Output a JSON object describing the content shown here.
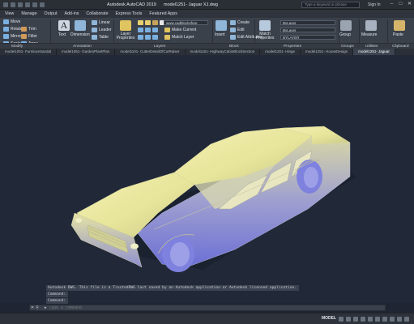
{
  "titlebar": {
    "app_title": "Autodesk AutoCAD 2019",
    "file_title": "model1251- Jaguar XJ.dwg",
    "search_placeholder": "Type a keyword or phrase",
    "signin": "Sign In"
  },
  "menu": [
    "View",
    "Manage",
    "Output",
    "Add-ins",
    "Collaborate",
    "Express Tools",
    "Featured Apps"
  ],
  "ribbon": {
    "modify": {
      "move": "Move",
      "rotate": "Rotate",
      "trim": "Trim",
      "copy": "Copy",
      "mirror": "Mirror",
      "fillet": "Fillet",
      "stretch": "Stretch",
      "scale": "Scale",
      "array": "Array"
    },
    "annotation": {
      "text": "Text",
      "dimension": "Dimension",
      "linear": "Linear",
      "leader": "Leader",
      "table": "Table"
    },
    "layers": {
      "layer_properties": "Layer Properties",
      "layer_value": "www.cadblocksfree",
      "make_current": "Make Current",
      "match_layer": "Match Layer"
    },
    "block": {
      "insert": "Insert",
      "create": "Create",
      "edit": "Edit",
      "edit_attributes": "Edit Attributes"
    },
    "properties": {
      "match_properties": "Match Properties",
      "color": "ByLayer",
      "linetype": "ByLayer",
      "lineweight": "BYLAYER"
    },
    "groups": {
      "group": "Group"
    },
    "utilities": {
      "measure": "Measure"
    },
    "clipboard": {
      "paste": "Paste"
    }
  },
  "panels": [
    "Modify",
    "Annotation",
    "Layers",
    "Block",
    "Properties",
    "Groups",
    "Utilities",
    "Clipboard"
  ],
  "file_tabs": [
    {
      "label": "model1001- FurnitureSandal",
      "active": false
    },
    {
      "label": "model1051- GardenPlantPlan",
      "active": false
    },
    {
      "label": "model1101- CutterDetailOfCutRaiser",
      "active": false
    },
    {
      "label": "model1151- HighwayCabinBlockSection",
      "active": false
    },
    {
      "label": "model1201- Hinge",
      "active": false
    },
    {
      "label": "model1251- HouseDesign",
      "active": false
    },
    {
      "label": "model1251- Jaguar",
      "active": true
    }
  ],
  "command": {
    "history": [
      "Autodesk DWG.  This file is a TrustedDWG last saved by an Autodesk application or Autodesk licensed application.",
      "Command:",
      "Command:"
    ],
    "placeholder": "Type a command"
  },
  "status": {
    "model": "MODEL"
  },
  "colors": {
    "body": "#eeeeA2",
    "shadow": "#7b7fd8",
    "background": "#212838"
  }
}
